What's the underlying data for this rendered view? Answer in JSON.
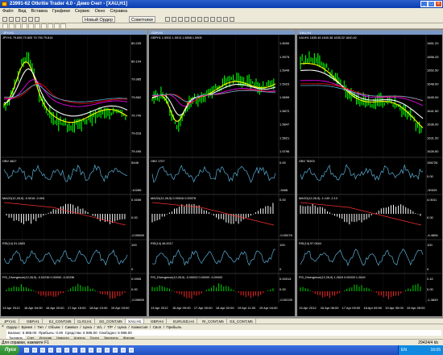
{
  "app": {
    "title": "23991-62 Otkritie Trader 4.0 - Демо Счет - [XAU,H1]",
    "window_buttons": [
      "_",
      "□",
      "×"
    ]
  },
  "menu": [
    "Файл",
    "Вид",
    "Вставка",
    "Графики",
    "Сервис",
    "Окно",
    "Справка"
  ],
  "toolbar": {
    "new_order": "Новый Ордер",
    "advisors": "Советники"
  },
  "charts": [
    {
      "title": "JPY,H1",
      "header": "JPYH1 79.895 79.805 79.790 79.814",
      "price_labels": [
        "80.225",
        "80.104",
        "79.985",
        "79.862",
        "79.740",
        "79.618",
        "79.495"
      ],
      "obv_label": "OBV 4847",
      "obv_scale": [
        "5448",
        "-10286"
      ],
      "macd_label": "MACD(12,26,9) -0.0016 -0.004",
      "macd_scale": [
        "0.1606",
        "0.00",
        "-0.09065"
      ],
      "rsi_label": "RSI(14) 51.1883",
      "rsi_scale": [
        "100",
        "0"
      ],
      "fis_label": "FIS_Divergence(12,26,9) -0.02236 0.00000 -0.02236",
      "fis_scale": [
        "0.0905",
        "0.00",
        "-0.09655"
      ],
      "dates": [
        "13 Apr 2012",
        "16 Apr 04:00",
        "16 Apr 20:00",
        "17 Apr 15:00",
        "18 Apr 10:00",
        "19 Apr 03:00"
      ]
    },
    {
      "title": "GBP,H1",
      "header": "GBPH1 1.5902 1.5913 1.5898 1.5909",
      "price_labels": [
        "1.6000",
        "1.5975",
        "1.5949",
        "1.5923",
        "1.5899",
        "1.5872",
        "1.5847",
        "1.5821",
        "1.5796"
      ],
      "obv_label": "OBV 1707",
      "obv_scale": [
        "0.00",
        "-3466"
      ],
      "macd_label": "MACD(12,26,9) 0.00016 0.00078",
      "macd_scale": [
        "0.00",
        "-0.00076"
      ],
      "rsi_label": "RSI(14) 46.0017",
      "rsi_scale": [
        "100",
        "0"
      ],
      "fis_label": "FIS_Divergence(12,26,9) -0.00002 0.00000 -0.00002",
      "fis_scale": [
        "0.00014",
        "0.00",
        "-0.00139"
      ],
      "dates": [
        "13 Apr 2012",
        "16 Apr 09:00",
        "17 Apr 00:00",
        "18 Apr 02:00",
        "19 Apr 11:00",
        "19 Apr 04:00"
      ]
    },
    {
      "title": "XAU,H1",
      "header": "XAUH1 1635.46 1640.38 1635.22 1640.42",
      "price_labels": [
        "1661.20",
        "1656.25",
        "1652.50",
        "1648.00",
        "1645.00",
        "1641.50",
        "1636.00",
        "1631.00",
        "1626.50"
      ],
      "obv_label": "OBV 76303",
      "obv_scale": [
        "156726",
        "0.00",
        "-30325"
      ],
      "macd_label": "MACD(12,26,9) -1.149 -2.13",
      "macd_scale": [
        "4.0041",
        "0.00",
        "-4.4806"
      ],
      "rsi_label": "RSI(14) 57.0644",
      "rsi_scale": [
        "100",
        "0"
      ],
      "fis_label": "FIS_Divergence(12,26,9) 1.2619 0.00000 1.2619",
      "fis_scale": [
        "2.42",
        "0.00",
        "-1.3849"
      ],
      "dates": [
        "13 Apr 2012",
        "16 Apr 08:00",
        "17 Apr 09:00",
        "18 Apr 09:00",
        "19 Apr 05:00",
        "19 Apr 05:00"
      ]
    }
  ],
  "chart_tabs": [
    "JPY,H1",
    "GBP,H1",
    "EJ_CONT,M5",
    "CL#3,H1",
    "SG_CONT,M5",
    "XAU,H1",
    "GBP,H4",
    "EURUSD,H4",
    "RI_CONT,M5",
    "GS_CONT,M5"
  ],
  "active_chart_tab": "XAU,H1",
  "terminal": {
    "header": "Ордер /  Время  /  Тип  /  Объем  /  Символ  /  Цена  /  S/L  /  T/P  /  Цена  /  Комиссия  /  Своп  /  Прибыль",
    "balance": "Баланс: 6 988.00  Прибыль: 0.00  Средства: 6 988.00  Свободно: 6 988.00",
    "tabs": [
      "Торговля",
      "Счет",
      "История",
      "Новости",
      "Алерты",
      "Почта",
      "Эксперты",
      "Журнал"
    ]
  },
  "status": {
    "help_text": "Для справки, нажмите F1",
    "connection": "29424/4 kb"
  },
  "taskbar": {
    "start_label": "Пуск",
    "lang": "EN",
    "clock": "16:05"
  },
  "colors": {
    "chart_bg": "#000000",
    "bars": "#00ff00",
    "ma_fast": "#ffff00",
    "ma_slow": "#ff00ff",
    "ma_mid": "#ffffff",
    "ma_long": "#ff0000",
    "indicator": "#5ab0d8",
    "hist": "#ffffff",
    "signal": "#ff3030"
  }
}
